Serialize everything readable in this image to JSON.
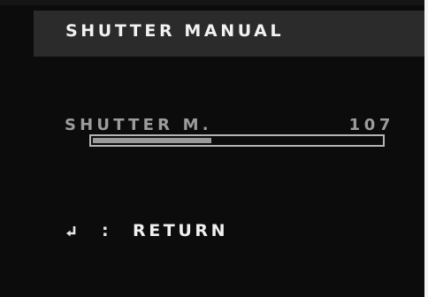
{
  "menu": {
    "title": "SHUTTER MANUAL"
  },
  "setting": {
    "label": "SHUTTER M.",
    "value": "107",
    "level_fraction": 0.41
  },
  "footer": {
    "return_icon": "return-arrow-icon",
    "separator": ":",
    "return_label": "RETURN"
  },
  "colors": {
    "background": "#0c0c0c",
    "header_background": "#2b2b2b",
    "title_text": "#f2f2f2",
    "setting_text": "#9c9c9c",
    "bar_border": "#b4b4b4",
    "bar_fill": "#9a9a9a"
  }
}
